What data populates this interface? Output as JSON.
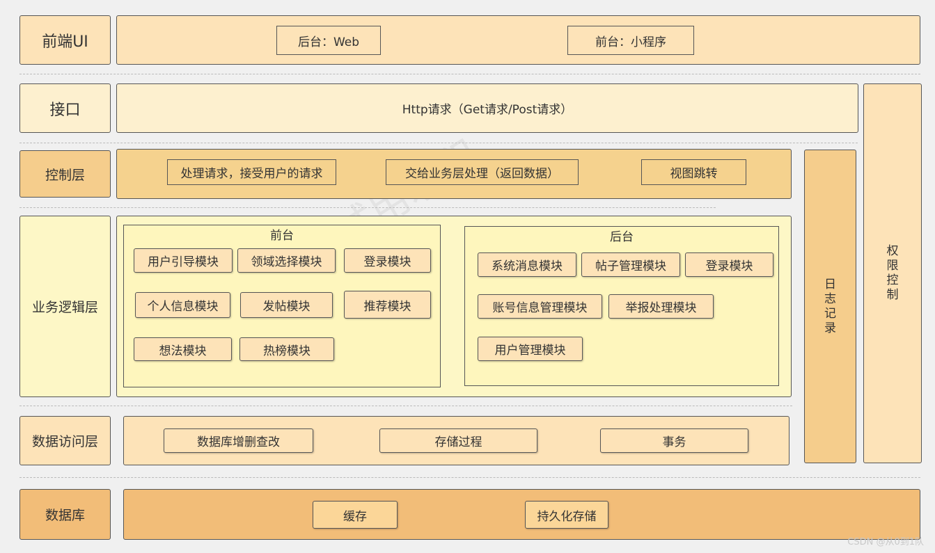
{
  "layers": {
    "frontend": {
      "label": "前端UI",
      "items": [
        "后台：Web",
        "前台：小程序"
      ]
    },
    "interface": {
      "label": "接口",
      "content": "Http请求（Get请求/Post请求）"
    },
    "control": {
      "label": "控制层",
      "items": [
        "处理请求，接受用户的请求",
        "交给业务层处理（返回数据）",
        "视图跳转"
      ]
    },
    "business": {
      "label": "业务逻辑层",
      "front": {
        "title": "前台",
        "modules": [
          "用户引导模块",
          "领域选择模块",
          "登录模块",
          "个人信息模块",
          "发帖模块",
          "推荐模块",
          "想法模块",
          "热榜模块"
        ]
      },
      "back": {
        "title": "后台",
        "modules": [
          "系统消息模块",
          "帖子管理模块",
          "登录模块",
          "账号信息管理模块",
          "举报处理模块",
          "用户管理模块"
        ]
      }
    },
    "data_access": {
      "label": "数据访问层",
      "items": [
        "数据库增删查改",
        "存储过程",
        "事务"
      ]
    },
    "database": {
      "label": "数据库",
      "items": [
        "缓存",
        "持久化存储"
      ]
    }
  },
  "side": {
    "log": [
      "日",
      "志",
      "记",
      "录"
    ],
    "auth": [
      "权",
      "限",
      "控",
      "制"
    ]
  },
  "watermark": "试用水印",
  "credit": "CSDN @从0到1队",
  "colors": {
    "frontend": "#fde3b8",
    "interface": "#fdf0cf",
    "control_label": "#f5cd8c",
    "control_bar": "#f5d28e",
    "business": "#fdf7c6",
    "inner_panel": "#fef6bd",
    "data_access": "#fde3b8",
    "database": "#f2bd78",
    "log": "#f5cd8c",
    "auth": "#fde3b8"
  }
}
